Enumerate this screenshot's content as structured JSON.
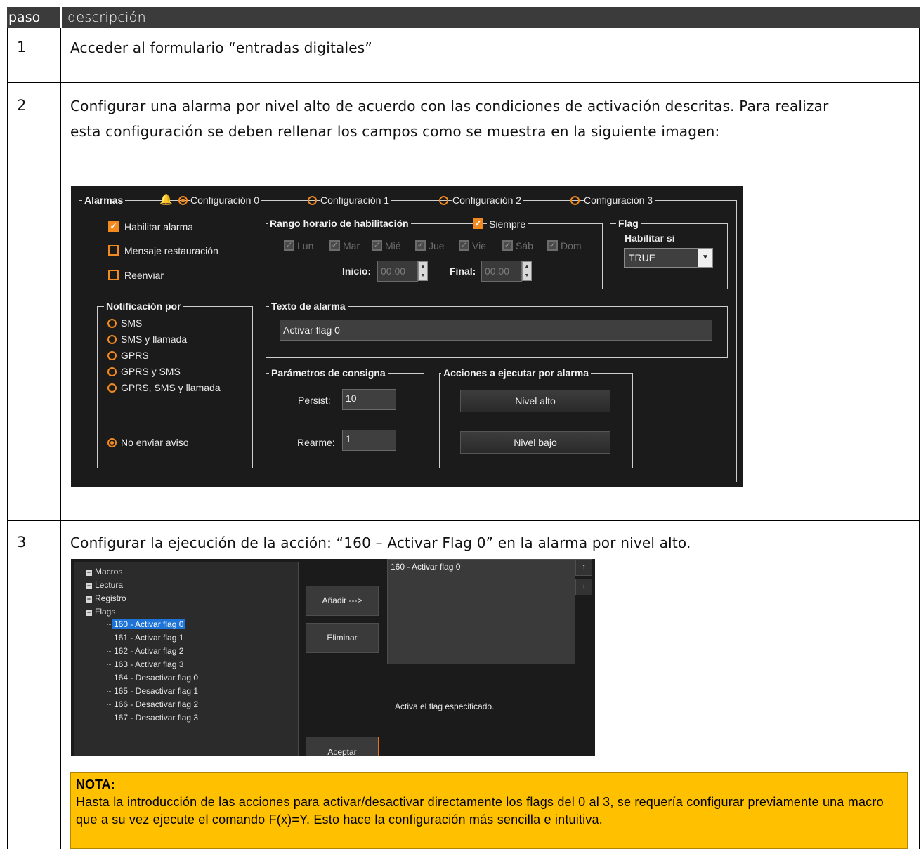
{
  "table": {
    "header": {
      "paso": "paso",
      "descripcion": "descripción"
    },
    "rows": [
      {
        "num": "1",
        "text": "Acceder al formulario “entradas digitales”"
      },
      {
        "num": "2",
        "text_line1": "Configurar una alarma por nivel alto de acuerdo con las condiciones de activación descritas. Para realizar",
        "text_line2": "esta configuración se deben rellenar los campos como se muestra en la siguiente imagen:"
      },
      {
        "num": "3",
        "text": "Configurar la ejecución de la acción: “160 – Activar Flag 0” en la alarma por nivel alto."
      }
    ]
  },
  "alarm_panel": {
    "legend": "Alarmas",
    "configs": [
      "Configuración 0",
      "Configuración 1",
      "Configuración 2",
      "Configuración 3"
    ],
    "selected_config": "Configuración 0",
    "checks": [
      {
        "label": "Habilitar alarma",
        "checked": true
      },
      {
        "label": "Mensaje restauración",
        "checked": false
      },
      {
        "label": "Reenviar",
        "checked": false
      }
    ],
    "schedule": {
      "legend": "Rango horario de habilitación",
      "always_label": "Siempre",
      "days": [
        "Lun",
        "Mar",
        "Mié",
        "Jue",
        "Vie",
        "Sáb",
        "Dom"
      ],
      "start_label": "Inicio:",
      "start_value": "00:00",
      "end_label": "Final:",
      "end_value": "00:00"
    },
    "flag": {
      "legend": "Flag",
      "label": "Habilitar si",
      "value": "TRUE"
    },
    "notification": {
      "legend": "Notificación por",
      "options": [
        "SMS",
        "SMS y llamada",
        "GPRS",
        "GPRS y SMS",
        "GPRS, SMS y llamada"
      ],
      "no_notice": "No enviar aviso",
      "selected": "No enviar aviso"
    },
    "alarm_text": {
      "legend": "Texto de alarma",
      "value": "Activar flag 0"
    },
    "params": {
      "legend": "Parámetros de consigna",
      "persist_label": "Persist:",
      "persist_value": "10",
      "rearm_label": "Rearme:",
      "rearm_value": "1"
    },
    "actions": {
      "legend": "Acciones a ejecutar por alarma",
      "high": "Nivel alto",
      "low": "Nivel bajo"
    }
  },
  "action_editor": {
    "tree": {
      "groups": [
        "Macros",
        "Lectura",
        "Registro",
        "Flags"
      ],
      "flag_items": [
        "160 - Activar flag 0",
        "161 - Activar flag 1",
        "162 - Activar flag 2",
        "163 - Activar flag 3",
        "164 - Desactivar flag 0",
        "165 - Desactivar flag 1",
        "166 - Desactivar flag 2",
        "167 - Desactivar flag 3"
      ],
      "selected": "160 - Activar flag 0"
    },
    "add_button": "Añadir --->",
    "remove_button": "Eliminar",
    "accept_button": "Aceptar",
    "selected_list": [
      "160 - Activar flag 0"
    ],
    "up_arrow": "↑",
    "down_arrow": "↓",
    "description": "Activa el flag especificado."
  },
  "nota": {
    "title": "NOTA:",
    "body": "Hasta la introducción de las acciones para activar/desactivar directamente los flags del 0 al 3, se requería configurar previamente una macro que a su vez ejecute el comando F(x)=Y. Esto hace la configuración más sencilla e intuitiva."
  },
  "colors": {
    "accent": "#f28a1f",
    "panel_bg": "#1b1b1b",
    "note_bg": "#ffc000",
    "header_bg": "#3b3b3b",
    "tree_selection": "#1e73d6"
  }
}
